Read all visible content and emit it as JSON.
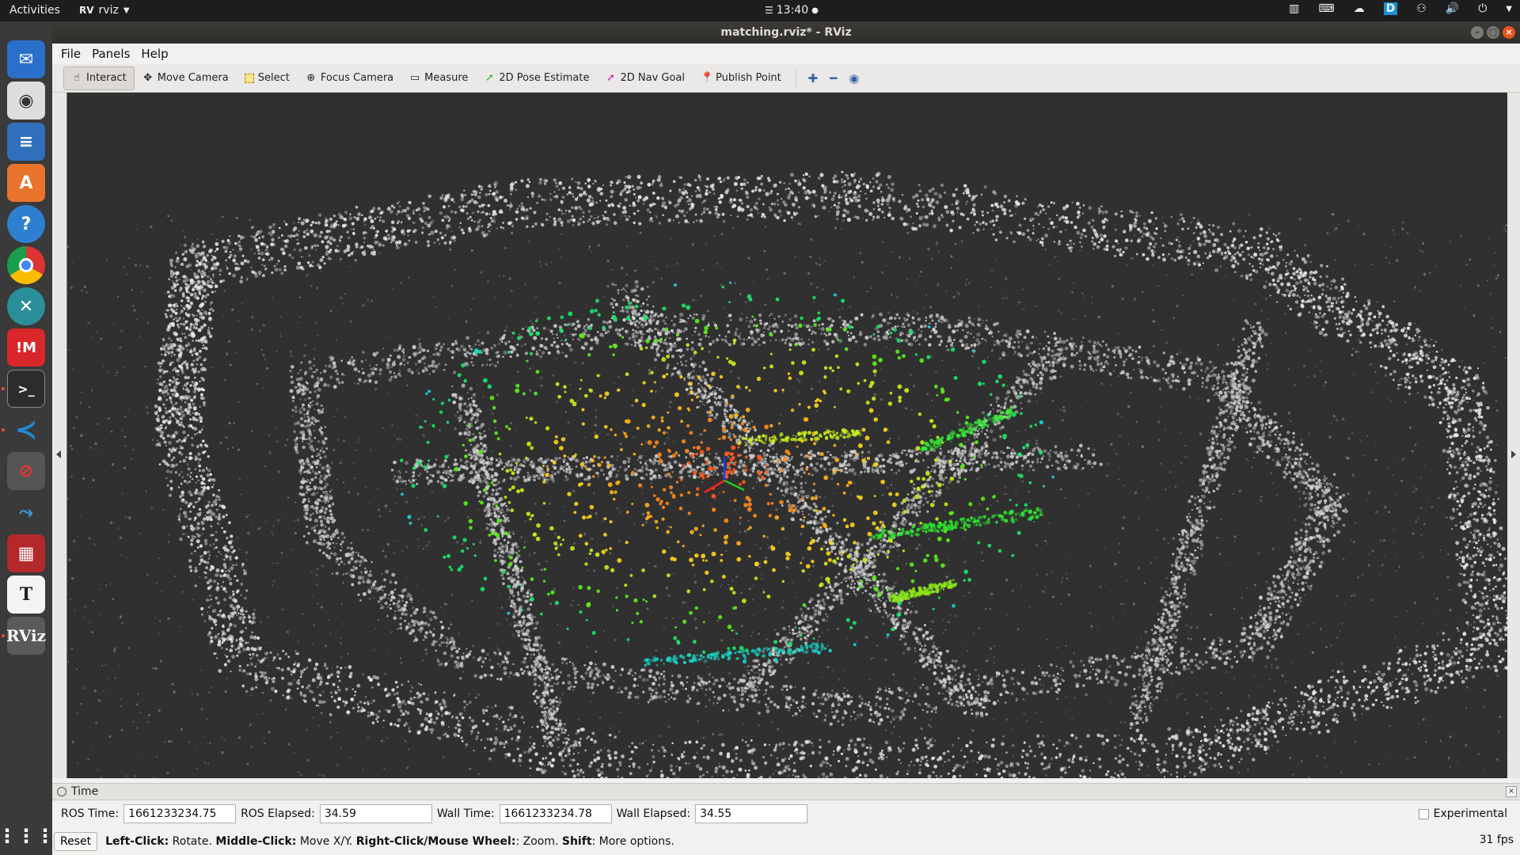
{
  "topbar": {
    "activities": "Activities",
    "app_name": "rviz",
    "time": "13:40"
  },
  "window": {
    "title": "matching.rviz* - RViz"
  },
  "menu": {
    "items": [
      "File",
      "Panels",
      "Help"
    ]
  },
  "toolbar": {
    "tools": [
      "Interact",
      "Move Camera",
      "Select",
      "Focus Camera",
      "Measure",
      "2D Pose Estimate",
      "2D Nav Goal",
      "Publish Point"
    ],
    "active_tool": "Interact"
  },
  "time_panel": {
    "title": "Time",
    "ros_time_label": "ROS Time:",
    "ros_time_value": "1661233234.75",
    "ros_elapsed_label": "ROS Elapsed:",
    "ros_elapsed_value": "34.59",
    "wall_time_label": "Wall Time:",
    "wall_time_value": "1661233234.78",
    "wall_elapsed_label": "Wall Elapsed:",
    "wall_elapsed_value": "34.55",
    "experimental_label": "Experimental"
  },
  "status": {
    "reset_label": "Reset",
    "left_click": "Left-Click:",
    "left_click_desc": "Rotate.",
    "middle_click": "Middle-Click:",
    "middle_click_desc": "Move X/Y.",
    "right_click": "Right-Click/Mouse Wheel:",
    "right_click_desc": ": Zoom.",
    "shift": "Shift",
    "shift_desc": ": More options.",
    "fps": "31 fps"
  },
  "colors": {
    "accent": "#e95420",
    "viewport_bg": "#303030"
  }
}
